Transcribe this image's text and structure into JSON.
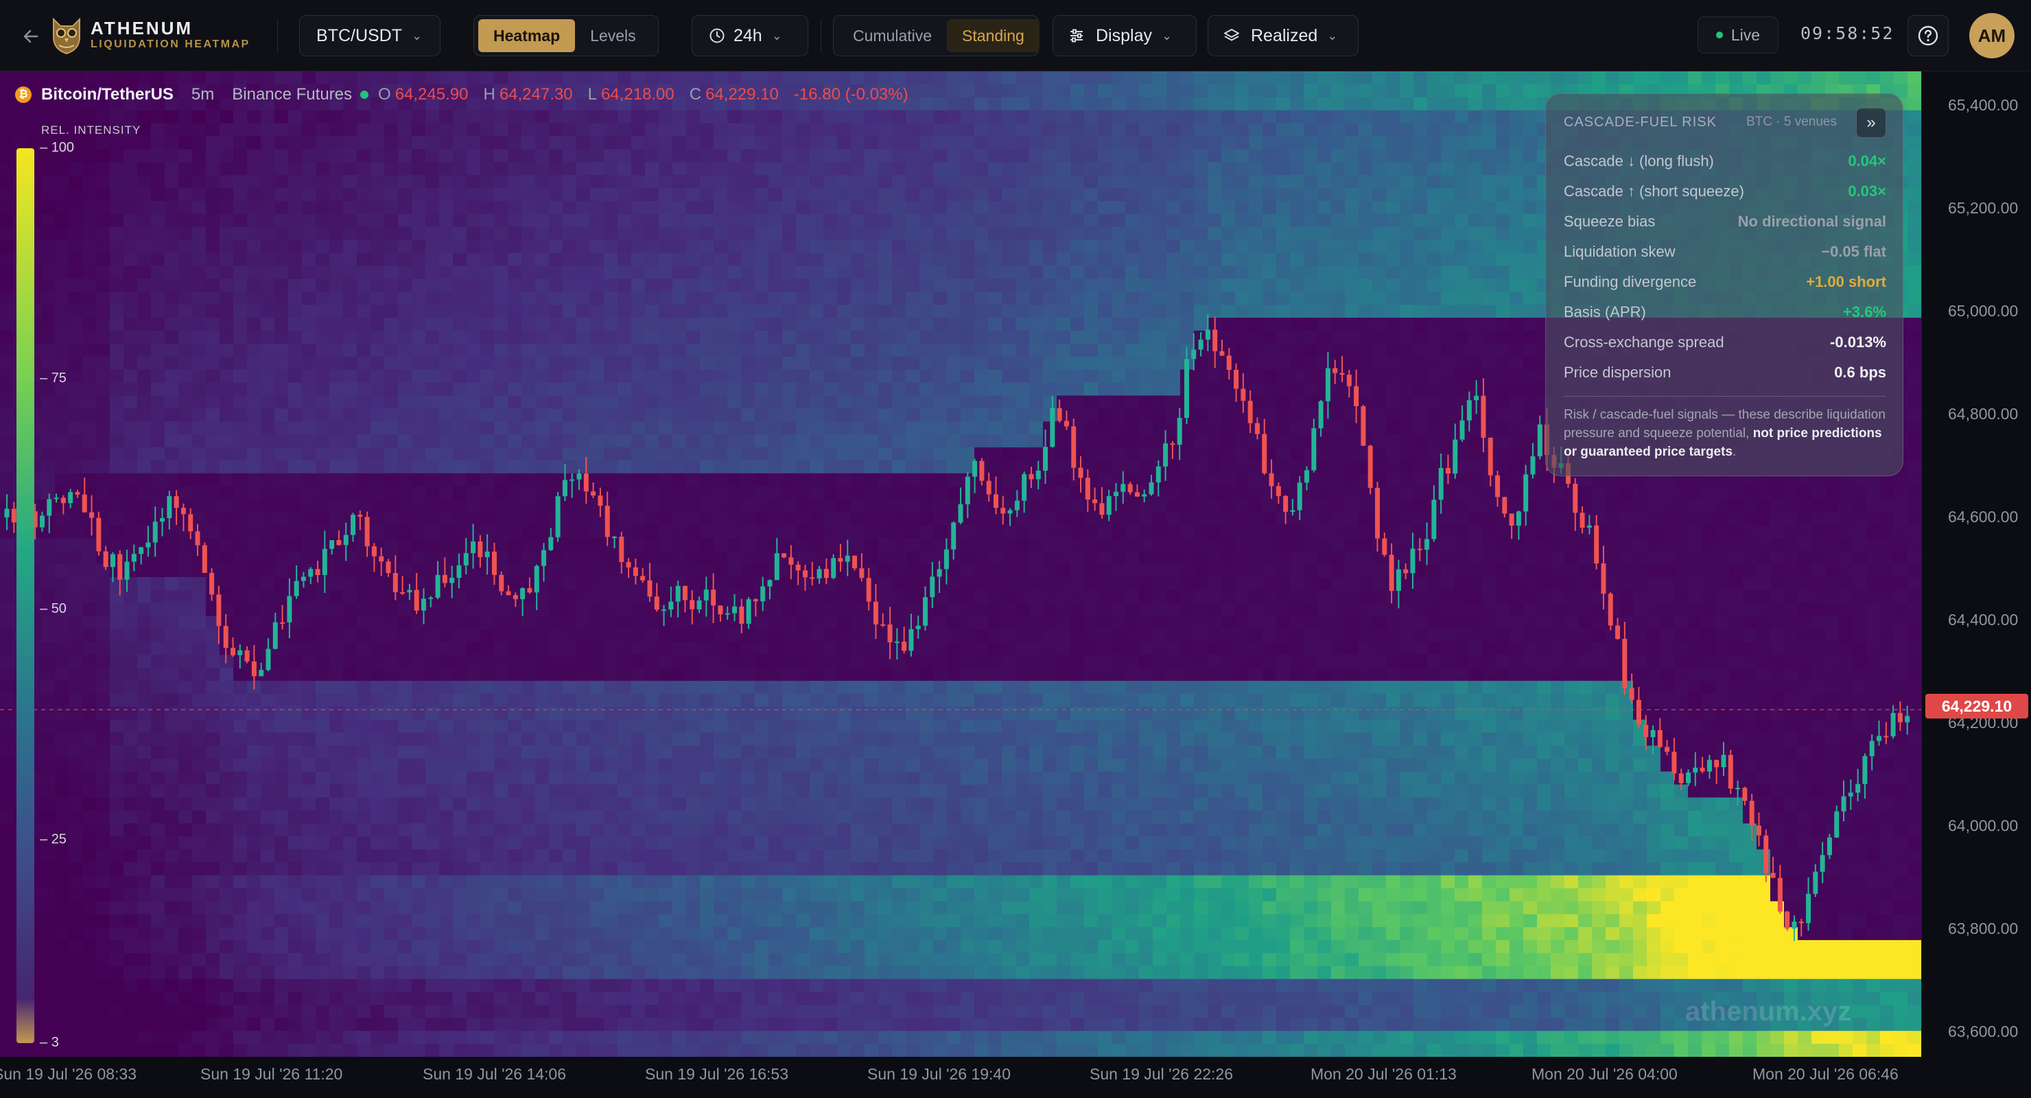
{
  "brand": {
    "name": "ATHENUM",
    "subtitle": "LIQUIDATION HEATMAP"
  },
  "toolbar": {
    "pair": "BTC/USDT",
    "view_tabs": [
      {
        "label": "Heatmap",
        "active": true
      },
      {
        "label": "Levels",
        "active": false
      }
    ],
    "range": "24h",
    "mode_tabs": [
      {
        "label": "Cumulative",
        "active": false
      },
      {
        "label": "Standing",
        "active": true
      }
    ],
    "display_label": "Display",
    "realized_label": "Realized",
    "live_label": "Live",
    "clock": "09:58:52",
    "avatar_initials": "AM"
  },
  "symbol": {
    "name": "Bitcoin/TetherUS",
    "interval": "5m",
    "exchange": "Binance Futures",
    "ohlc": [
      {
        "label": "O",
        "value": "64,245.90"
      },
      {
        "label": "H",
        "value": "64,247.30"
      },
      {
        "label": "L",
        "value": "64,218.00"
      },
      {
        "label": "C",
        "value": "64,229.10"
      }
    ],
    "change": "-16.80 (-0.03%)"
  },
  "intensity_scale": {
    "title": "REL. INTENSITY",
    "labels": [
      "100",
      "75",
      "50",
      "25",
      "3"
    ]
  },
  "risk_panel": {
    "title": "CASCADE-FUEL RISK",
    "subtitle": "BTC · 5 venues",
    "rows": [
      {
        "label": "Cascade ↓ (long flush)",
        "value": "0.04×",
        "tone": "green"
      },
      {
        "label": "Cascade ↑ (short squeeze)",
        "value": "0.03×",
        "tone": "green"
      },
      {
        "label": "Squeeze bias",
        "value": "No directional signal",
        "tone": "grey"
      },
      {
        "label": "Liquidation skew",
        "value": "−0.05 flat",
        "tone": "grey"
      },
      {
        "label": "Funding divergence",
        "value": "+1.00 short",
        "tone": "gold"
      },
      {
        "label": "Basis (APR)",
        "value": "+3.6%",
        "tone": "green"
      },
      {
        "label": "Cross-exchange spread",
        "value": "-0.013%",
        "tone": "white"
      },
      {
        "label": "Price dispersion",
        "value": "0.6 bps",
        "tone": "white"
      }
    ],
    "note_plain": "Risk / cascade-fuel signals — these describe liquidation pressure and squeeze potential,",
    "note_bold": "not price predictions or guaranteed price targets",
    "note_end": "."
  },
  "price_axis": [
    "65,400.00",
    "65,200.00",
    "65,000.00",
    "64,800.00",
    "64,600.00",
    "64,400.00",
    "64,200.00",
    "64,000.00",
    "63,800.00",
    "63,600.00"
  ],
  "last_price": "64,229.10",
  "time_axis": [
    "Sun 19 Jul '26 08:33",
    "Sun 19 Jul '26 11:20",
    "Sun 19 Jul '26 14:06",
    "Sun 19 Jul '26 16:53",
    "Sun 19 Jul '26 19:40",
    "Sun 19 Jul '26 22:26",
    "Mon 20 Jul '26 01:13",
    "Mon 20 Jul '26 04:00",
    "Mon 20 Jul '26 06:46"
  ],
  "watermark": "athenum.xyz",
  "colors": {
    "accent": "#c39a52",
    "up": "#22b596",
    "down": "#ef5350",
    "live": "#22c57a"
  },
  "chart_data": {
    "type": "heatmap",
    "price_range": [
      63560,
      65460
    ],
    "last_price": 64229.1,
    "price_path": [
      64600,
      64620,
      64580,
      64640,
      64660,
      64600,
      64520,
      64500,
      64540,
      64580,
      64640,
      64560,
      64480,
      64380,
      64320,
      64300,
      64380,
      64440,
      64480,
      64520,
      64560,
      64600,
      64540,
      64480,
      64440,
      64420,
      64480,
      64520,
      64560,
      64500,
      64460,
      64440,
      64520,
      64620,
      64680,
      64640,
      64580,
      64520,
      64460,
      64420,
      64460,
      64400,
      64460,
      64420,
      64400,
      64440,
      64520,
      64500,
      64480,
      64500,
      64520,
      64480,
      64420,
      64380,
      64360,
      64420,
      64520,
      64620,
      64720,
      64640,
      64600,
      64660,
      64720,
      64820,
      64700,
      64600,
      64640,
      64680,
      64640,
      64680,
      64760,
      64920,
      64980,
      64900,
      64860,
      64760,
      64640,
      64620,
      64700,
      64880,
      64900,
      64800,
      64600,
      64480,
      64520,
      64560,
      64680,
      64740,
      64860,
      64700,
      64580,
      64660,
      64760,
      64700,
      64640,
      64560,
      64440,
      64300,
      64200,
      64160,
      64120,
      64100,
      64140,
      64120,
      64060,
      63980,
      63880,
      63800,
      63860,
      63940,
      64040,
      64100,
      64160,
      64200,
      64229
    ],
    "price_path_range": {
      "start": "Sun 19 Jul '26 08:33",
      "end": "Mon 20 Jul '26 09:58"
    }
  }
}
